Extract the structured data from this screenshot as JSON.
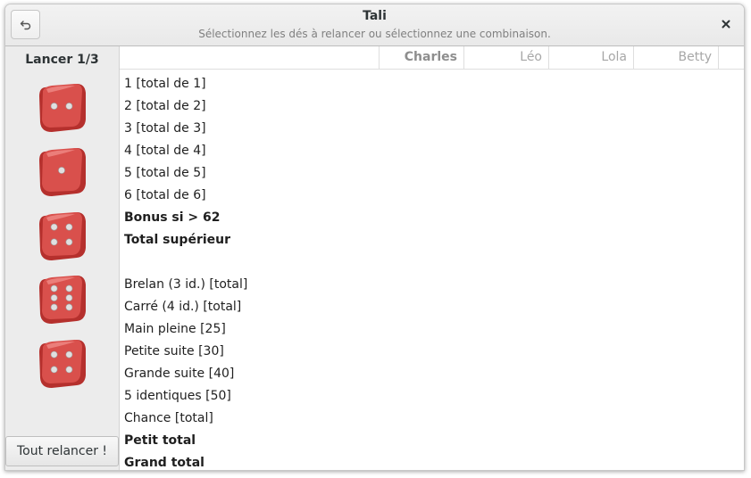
{
  "window": {
    "title": "Tali",
    "subtitle": "Sélectionnez les dés à relancer ou sélectionnez une combinaison."
  },
  "toolbar": {
    "undo_icon": "undo-icon",
    "close_icon": "close-icon"
  },
  "sidebar": {
    "roll_label": "Lancer 1/3",
    "dice": [
      {
        "value": 2
      },
      {
        "value": 1
      },
      {
        "value": 4
      },
      {
        "value": 6
      },
      {
        "value": 4
      }
    ],
    "reroll_label": "Tout relancer !"
  },
  "players": [
    {
      "name": "Charles",
      "active": true
    },
    {
      "name": "Léo",
      "active": false
    },
    {
      "name": "Lola",
      "active": false
    },
    {
      "name": "Betty",
      "active": false
    }
  ],
  "rows": [
    {
      "label": "1 [total de 1]",
      "bold": false
    },
    {
      "label": "2 [total de 2]",
      "bold": false
    },
    {
      "label": "3 [total de 3]",
      "bold": false
    },
    {
      "label": "4 [total de 4]",
      "bold": false
    },
    {
      "label": "5 [total de 5]",
      "bold": false
    },
    {
      "label": "6 [total de 6]",
      "bold": false
    },
    {
      "label": "Bonus si > 62",
      "bold": true
    },
    {
      "label": "Total supérieur",
      "bold": true
    },
    {
      "label": "",
      "bold": false
    },
    {
      "label": "Brelan (3 id.) [total]",
      "bold": false
    },
    {
      "label": "Carré (4 id.) [total]",
      "bold": false
    },
    {
      "label": "Main pleine [25]",
      "bold": false
    },
    {
      "label": "Petite suite [30]",
      "bold": false
    },
    {
      "label": "Grande suite [40]",
      "bold": false
    },
    {
      "label": "5 identiques [50]",
      "bold": false
    },
    {
      "label": "Chance [total]",
      "bold": false
    },
    {
      "label": "Petit total",
      "bold": true
    },
    {
      "label": "Grand total",
      "bold": true
    }
  ],
  "colors": {
    "die_red": "#d9504c",
    "pip": "#e0e0e0"
  }
}
